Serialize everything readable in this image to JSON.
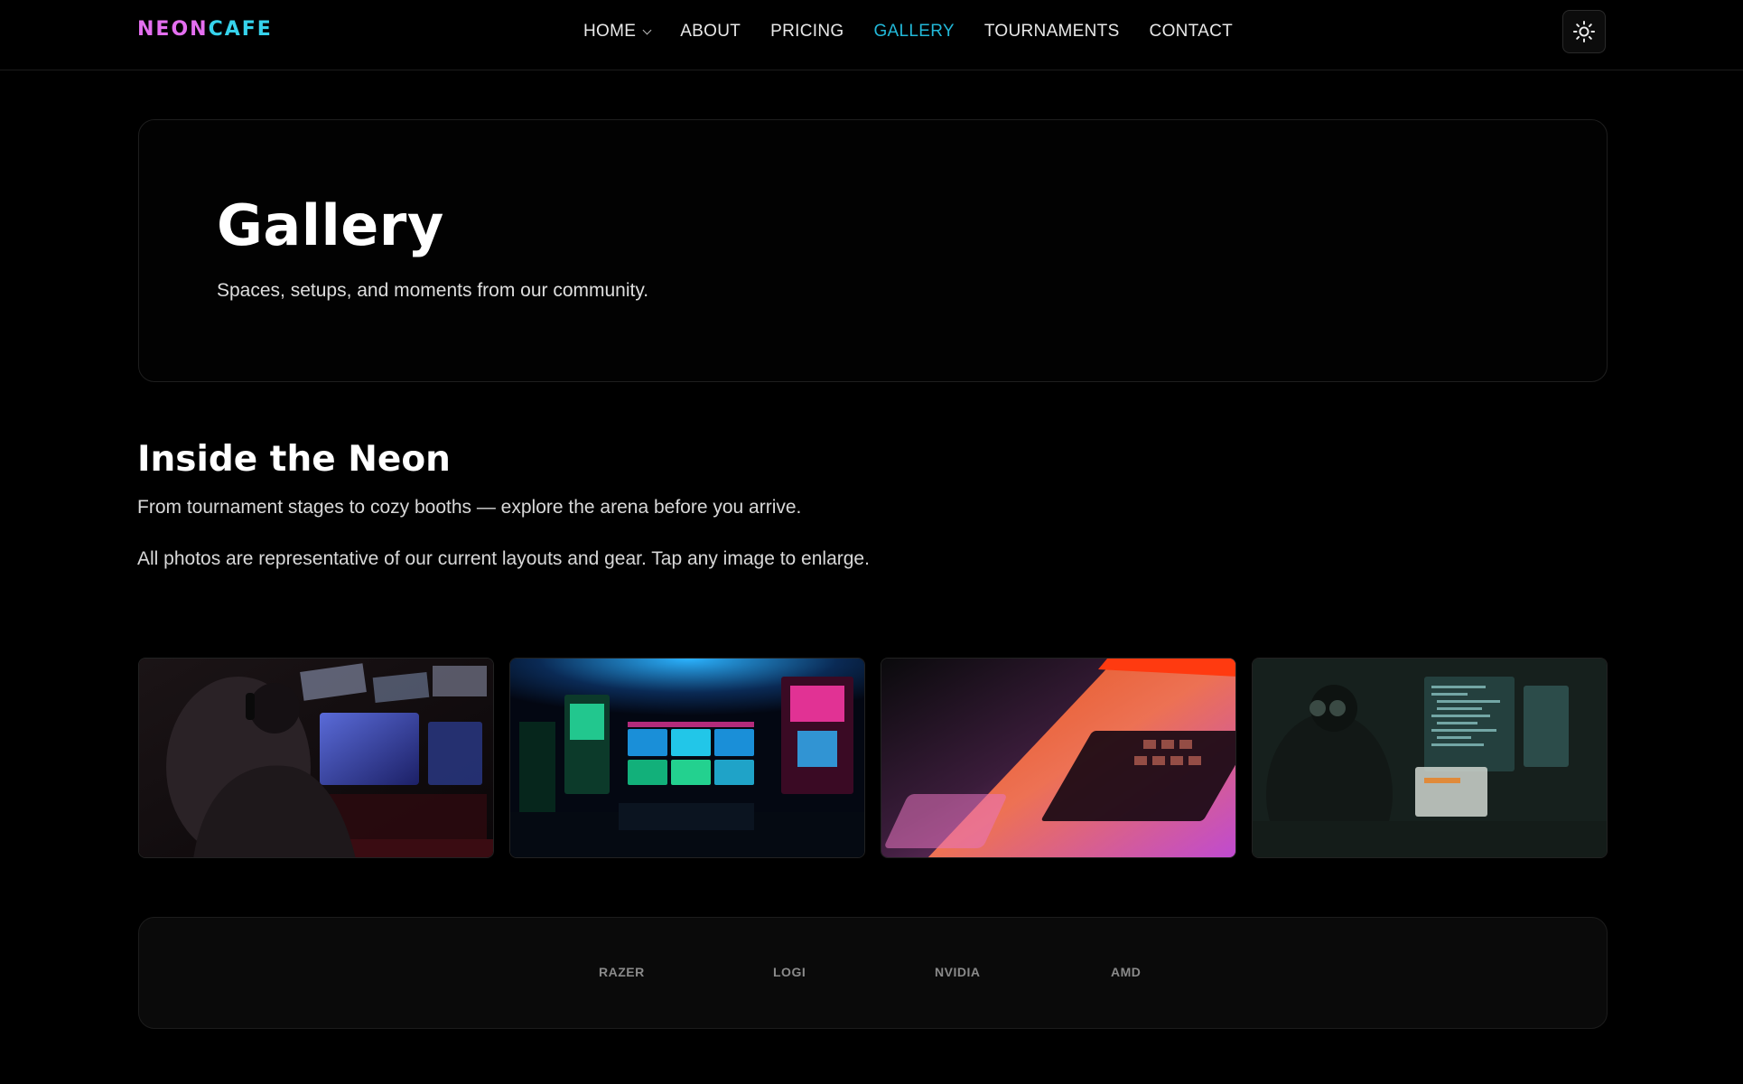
{
  "brand": {
    "logo_part1": "NEON",
    "logo_part2": "CAFE",
    "colors": {
      "logo_part1": "#e46ff0",
      "logo_part2": "#36d3ec",
      "accent": "#22b8d8"
    }
  },
  "nav": {
    "items": [
      {
        "label": "HOME",
        "has_dropdown": true,
        "active": false
      },
      {
        "label": "ABOUT",
        "active": false
      },
      {
        "label": "PRICING",
        "active": false
      },
      {
        "label": "GALLERY",
        "active": true
      },
      {
        "label": "TOURNAMENTS",
        "active": false
      },
      {
        "label": "CONTACT",
        "active": false
      }
    ],
    "theme_toggle_icon": "sun-icon"
  },
  "hero": {
    "title": "Gallery",
    "subtitle": "Spaces, setups, and moments from our community."
  },
  "section": {
    "title": "Inside the Neon",
    "paragraph1": "From tournament stages to cozy booths — explore the arena before you arrive.",
    "paragraph2": "All photos are representative of our current layouts and gear. Tap any image to enlarge."
  },
  "gallery": {
    "images": [
      {
        "subject": "gamer-with-headset-at-tournament-stage"
      },
      {
        "subject": "neon-arcade-room"
      },
      {
        "subject": "laptop-keyboard-neon-light"
      },
      {
        "subject": "coder-at-monitors-dark-room"
      }
    ]
  },
  "partners": {
    "items": [
      "RAZER",
      "LOGI",
      "NVIDIA",
      "AMD"
    ]
  }
}
